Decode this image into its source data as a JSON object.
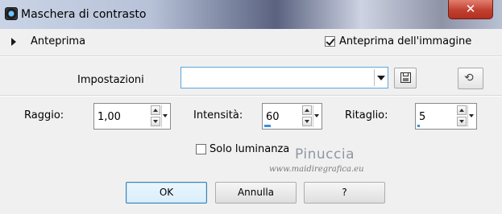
{
  "window": {
    "title": "Maschera di contrasto",
    "close_glyph": "✕"
  },
  "preview": {
    "label": "Anteprima",
    "image_preview_label": "Anteprima dell'immagine",
    "image_preview_checked": true
  },
  "settings": {
    "label": "Impostazioni",
    "value": ""
  },
  "fields": {
    "radius": {
      "label": "Raggio:",
      "value": "1,00"
    },
    "intensity": {
      "label": "Intensità:",
      "value": "60"
    },
    "clip": {
      "label": "Ritaglio:",
      "value": "5"
    }
  },
  "luminance": {
    "label": "Solo luminanza",
    "checked": false
  },
  "watermark": {
    "name": "Pinuccia",
    "url": "www.maidiregrafica.eu"
  },
  "buttons": {
    "ok": "OK",
    "cancel": "Annulla",
    "help": "?"
  }
}
